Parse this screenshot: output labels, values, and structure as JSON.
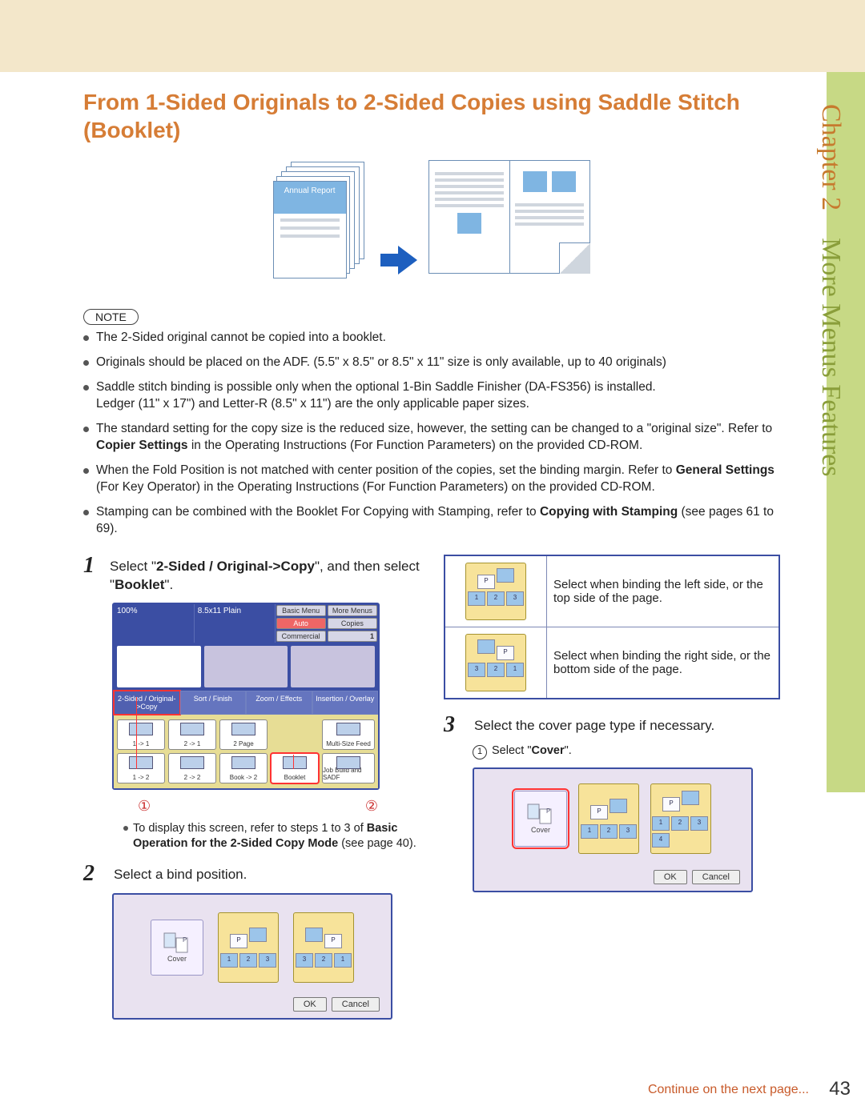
{
  "side": {
    "chapter": "Chapter 2",
    "section": "More Menus Features"
  },
  "title": "From 1-Sided Originals to 2-Sided Copies using Saddle Stitch (Booklet)",
  "illustration_label": "Annual Report",
  "note_label": "NOTE",
  "notes": {
    "n0": "The 2-Sided original cannot be copied into a booklet.",
    "n1": "Originals should be placed on the ADF. (5.5\" x 8.5\" or 8.5\" x 11\" size is only available, up to 40 originals)",
    "n2a": "Saddle stitch binding is possible only when the optional 1-Bin Saddle Finisher (DA-FS356) is installed.",
    "n2b": "Ledger (11\" x 17\") and Letter-R (8.5\" x 11\") are the only applicable paper sizes.",
    "n3a": "The standard setting for the copy size is the reduced size, however, the setting can be changed to a \"original size\". Refer to ",
    "n3b": "Copier Settings",
    "n3c": " in the Operating Instructions (For Function Parameters) on the provided CD-ROM.",
    "n4a": "When the Fold Position is not matched with center position of the copies, set the binding margin. Refer to ",
    "n4b": "General Settings",
    "n4c": " (For Key Operator) in the Operating Instructions (For Function Parameters) on the provided CD-ROM.",
    "n5a": "Stamping can be combined with the Booklet For Copying with Stamping, refer to ",
    "n5b": "Copying with Stamping",
    "n5c": " (see pages 61 to 69)."
  },
  "steps": {
    "s1a": "Select \"",
    "s1b": "2-Sided / Original->Copy",
    "s1c": "\", and then select \"",
    "s1d": "Booklet",
    "s1e": "\".",
    "s2": "Select a bind position.",
    "s3": "Select the cover page type if necessary."
  },
  "screenshot1": {
    "top": {
      "pct": "100%",
      "size": "8.5x11 Plain"
    },
    "top_btns": {
      "bm": "Basic Menu",
      "mm": "More Menus",
      "auto": "Auto",
      "cop": "Copies",
      "comm": "Commercial",
      "one": "1"
    },
    "tabs": {
      "t1": "2-Sided / Original->Copy",
      "t2": "Sort / Finish",
      "t3": "Zoom / Effects",
      "t4": "Insertion / Overlay"
    },
    "btns": {
      "b11": "1 -> 1",
      "b21": "2 -> 1",
      "b2p": "2 Page",
      "b12": "1 -> 2",
      "b22": "2 -> 2",
      "bk2": "Book -> 2",
      "bklt": "Booklet",
      "msf": "Multi-Size Feed",
      "jba": "Job Build and SADF"
    }
  },
  "screenshot1_note": {
    "a": "To display this screen, refer to steps 1 to 3 of ",
    "b": "Basic Operation for the 2-Sided Copy Mode",
    "c": " (see page 40)."
  },
  "circled": {
    "one": "①",
    "two": "②"
  },
  "bind_cover_label": "Cover",
  "bind_options": {
    "left": "Select when binding the left side, or the top side of the page.",
    "right": "Select when binding the right side, or the bottom side of the page."
  },
  "cover_sub": {
    "num": "1",
    "a": "Select \"",
    "b": "Cover",
    "c": "\"."
  },
  "ok": "OK",
  "cancel": "Cancel",
  "continue": "Continue on the next page...",
  "page_number": "43",
  "mini_labels": {
    "p": "P",
    "one": "1",
    "two": "2",
    "three": "3",
    "four": "4"
  }
}
